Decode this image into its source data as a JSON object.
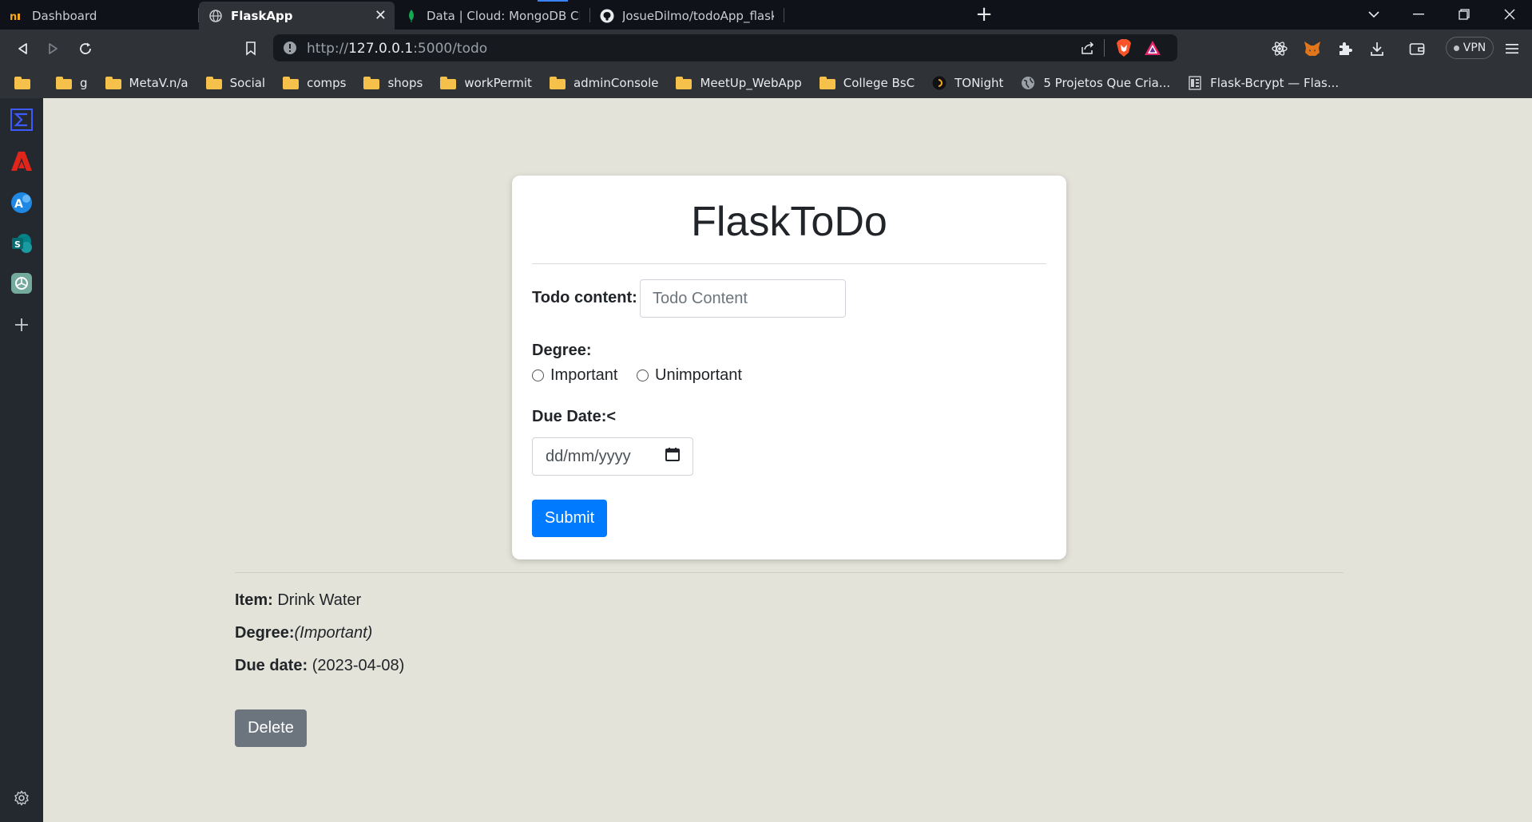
{
  "tabs": [
    {
      "title": "Dashboard",
      "favicon": "n-logo-icon",
      "active": false
    },
    {
      "title": "FlaskApp",
      "favicon": "globe-icon",
      "active": true
    },
    {
      "title": "Data | Cloud: MongoDB Cloud",
      "favicon": "mongodb-leaf-icon",
      "active": false
    },
    {
      "title": "JosueDilmo/todoApp_flask: ToDo App",
      "favicon": "github-icon",
      "active": false
    }
  ],
  "address_bar": {
    "scheme": "http://",
    "host": "127.0.0.1",
    "rest": ":5000/todo"
  },
  "vpn_label": "VPN",
  "bookmarks": [
    {
      "label": "",
      "icon": "folder-icon"
    },
    {
      "label": "g",
      "icon": "folder-icon"
    },
    {
      "label": "MetaV.n/a",
      "icon": "folder-icon"
    },
    {
      "label": "Social",
      "icon": "folder-icon"
    },
    {
      "label": "comps",
      "icon": "folder-icon"
    },
    {
      "label": "shops",
      "icon": "folder-icon"
    },
    {
      "label": "workPermit",
      "icon": "folder-icon"
    },
    {
      "label": "adminConsole",
      "icon": "folder-icon"
    },
    {
      "label": "MeetUp_WebApp",
      "icon": "folder-icon"
    },
    {
      "label": "College BsC",
      "icon": "folder-icon"
    },
    {
      "label": "TONight",
      "icon": "tonight-icon"
    },
    {
      "label": "5 Projetos Que Cria...",
      "icon": "globe-icon"
    },
    {
      "label": "Flask-Bcrypt — Flas...",
      "icon": "docs-icon"
    }
  ],
  "app": {
    "title": "FlaskToDo",
    "todo_label": "Todo content:",
    "todo_placeholder": "Todo Content",
    "degree_label": "Degree:",
    "degree_options": [
      "Important",
      "Unimportant"
    ],
    "due_label": "Due Date:<",
    "date_placeholder": "dd/mm/yyyy",
    "submit_label": "Submit"
  },
  "todo_items": [
    {
      "item_label": "Item:",
      "item_value": "Drink Water",
      "degree_label": "Degree:",
      "degree_value": "(Important)",
      "due_label": "Due date:",
      "due_value": "(2023-04-08)",
      "delete_label": "Delete"
    }
  ],
  "colors": {
    "page_bg": "#e4e3d9",
    "primary": "#007bff",
    "secondary": "#6c757d"
  }
}
